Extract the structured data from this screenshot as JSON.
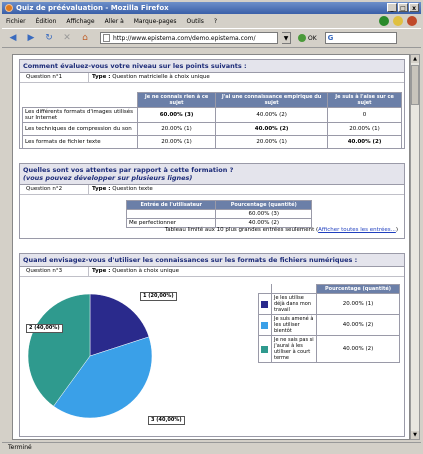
{
  "window": {
    "title": "Quiz de préévaluation - Mozilla Firefox",
    "buttons": [
      "_",
      "□",
      "x"
    ]
  },
  "menu": [
    "Fichier",
    "Édition",
    "Affichage",
    "Aller à",
    "Marque-pages",
    "Outils",
    "?"
  ],
  "toolbar": {
    "url": "http://www.epistema.com/demo.epistema.com/",
    "go_label": "OK",
    "search_value": "G"
  },
  "status": {
    "text": "Terminé"
  },
  "q1": {
    "heading": "Comment évaluez-vous votre niveau sur les points suivants :",
    "number": "Question n°1",
    "type_label": "Type :",
    "type_value": "Question matricielle à choix unique",
    "columns": [
      "Je ne connais rien à ce sujet",
      "J'ai une connaissance empirique du sujet",
      "Je suis à l'aise sur ce sujet"
    ],
    "rows": [
      {
        "label": "Les différents formats d'images utilisés sur Internet",
        "cells": [
          "60.00% (3)",
          "40.00% (2)",
          "0"
        ],
        "bold": [
          true,
          false,
          false
        ]
      },
      {
        "label": "Les techniques de compression du son",
        "cells": [
          "20.00% (1)",
          "40.00% (2)",
          "20.00% (1)"
        ],
        "bold": [
          false,
          true,
          false
        ]
      },
      {
        "label": "Les formats de fichier texte",
        "cells": [
          "20.00% (1)",
          "20.00% (1)",
          "40.00% (2)"
        ],
        "bold": [
          false,
          false,
          true
        ]
      }
    ]
  },
  "q2": {
    "heading_line1": "Quelles sont vos attentes par rapport à cette formation ?",
    "heading_line2": "(vous pouvez développer sur plusieurs lignes)",
    "number": "Question n°2",
    "type_label": "Type :",
    "type_value": "Question texte",
    "columns": [
      "Entrée de l'utilisateur",
      "Pourcentage (quantité)"
    ],
    "rows": [
      {
        "entry": "",
        "pct": "60.00% (3)"
      },
      {
        "entry": "Me perfectionner",
        "pct": "40.00% (2)"
      }
    ],
    "limit_note": "Tableau limité aux 10 plus grandes entrées seulement (",
    "limit_link": "Afficher toutes les entrées...",
    "limit_close": ")"
  },
  "q3": {
    "heading": "Quand envisagez-vous d'utiliser les connaissances sur les formats de fichiers numériques :",
    "number": "Question n°3",
    "type_label": "Type :",
    "type_value": "Question à choix unique",
    "column": "Pourcentage (quantité)",
    "rows": [
      {
        "label": "Je les utilise déjà dans mon travail",
        "pct": "20.00% (1)"
      },
      {
        "label": "Je suis amené à les utiliser bientôt",
        "pct": "40.00% (2)"
      },
      {
        "label": "Je ne sais pas si j'aurai à les utiliser à court terme",
        "pct": "40.00% (2)"
      }
    ],
    "pie_labels": [
      "1 (20,00%)",
      "2 (40,00%)",
      "3 (40,00%)"
    ]
  },
  "colors": {
    "slice1": "#2a2a8c",
    "slice2": "#3aa0e8",
    "slice3": "#2f9a8e"
  },
  "chart_data": {
    "type": "pie",
    "categories": [
      "Je les utilise déjà dans mon travail",
      "Je suis amené à les utiliser bientôt",
      "Je ne sais pas si j'aurai à les utiliser à court terme"
    ],
    "values": [
      20,
      40,
      40
    ],
    "slice_labels": [
      "1 (20,00%)",
      "3 (40,00%)",
      "2 (40,00%)"
    ]
  }
}
